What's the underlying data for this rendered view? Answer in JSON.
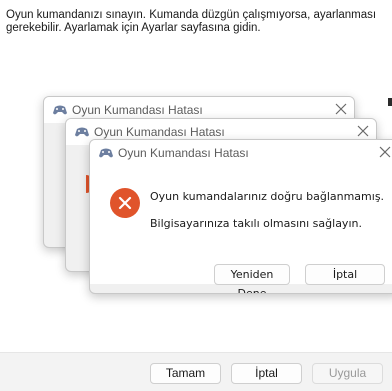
{
  "settings_page": {
    "instruction": "Oyun kumandanızı sınayın. Kumanda düzgün çalışmıyorsa, ayarlanması gerekebilir. Ayarlamak için Ayarlar sayfasına gidin.",
    "buttons": {
      "ok": "Tamam",
      "cancel": "İptal",
      "apply": "Uygula"
    }
  },
  "dialogs": [
    {
      "title": "Oyun Kumandası Hatası"
    },
    {
      "title": "Oyun Kumandası Hatası"
    },
    {
      "title": "Oyun Kumandası Hatası",
      "message_line1": "Oyun kumandalarınız doğru bağlanmamış.",
      "message_line2": "Bilgisayarınıza takılı olmasını sağlayın.",
      "retry_label": "Yeniden Dene",
      "cancel_label": "İptal"
    }
  ],
  "icons": {
    "title_icon": "gamepad-icon",
    "close_icon": "close-icon",
    "error_icon": "error-icon"
  },
  "colors": {
    "error_red": "#e0542b",
    "dialog_button_area": "#f0f0f0"
  }
}
